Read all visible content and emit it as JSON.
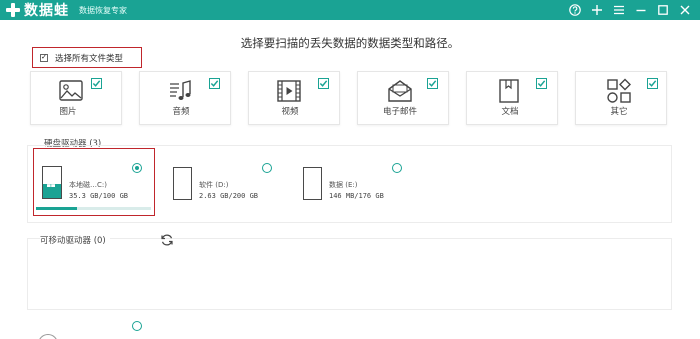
{
  "app": {
    "logo_text": "数据蛙",
    "subtitle": "数据恢复专家"
  },
  "heading": "选择要扫描的丢失数据的数据类型和路径。",
  "select_all": {
    "label": "选择所有文件类型",
    "checked": true
  },
  "file_types": [
    {
      "label": "图片",
      "icon": "image-icon",
      "checked": true
    },
    {
      "label": "音频",
      "icon": "music-icon",
      "checked": true
    },
    {
      "label": "视频",
      "icon": "video-icon",
      "checked": true
    },
    {
      "label": "电子邮件",
      "icon": "email-icon",
      "checked": true
    },
    {
      "label": "文档",
      "icon": "document-icon",
      "checked": true
    },
    {
      "label": "其它",
      "icon": "other-icon",
      "checked": true
    }
  ],
  "hard_disk": {
    "title": "硬盘驱动器 (3)",
    "drives": [
      {
        "name": "本地磁…C:)",
        "size": "35.3 GB/100 GB",
        "selected": true,
        "usage_fraction": 0.353
      },
      {
        "name": "软件 (D:)",
        "size": "2.63 GB/200 GB",
        "selected": false
      },
      {
        "name": "数据 (E:)",
        "size": "146 MB/176 GB",
        "selected": false
      }
    ]
  },
  "removable": {
    "title": "可移动驱动器 (0)"
  },
  "colors": {
    "accent": "#1aa394",
    "highlight_border": "#c0262c"
  }
}
